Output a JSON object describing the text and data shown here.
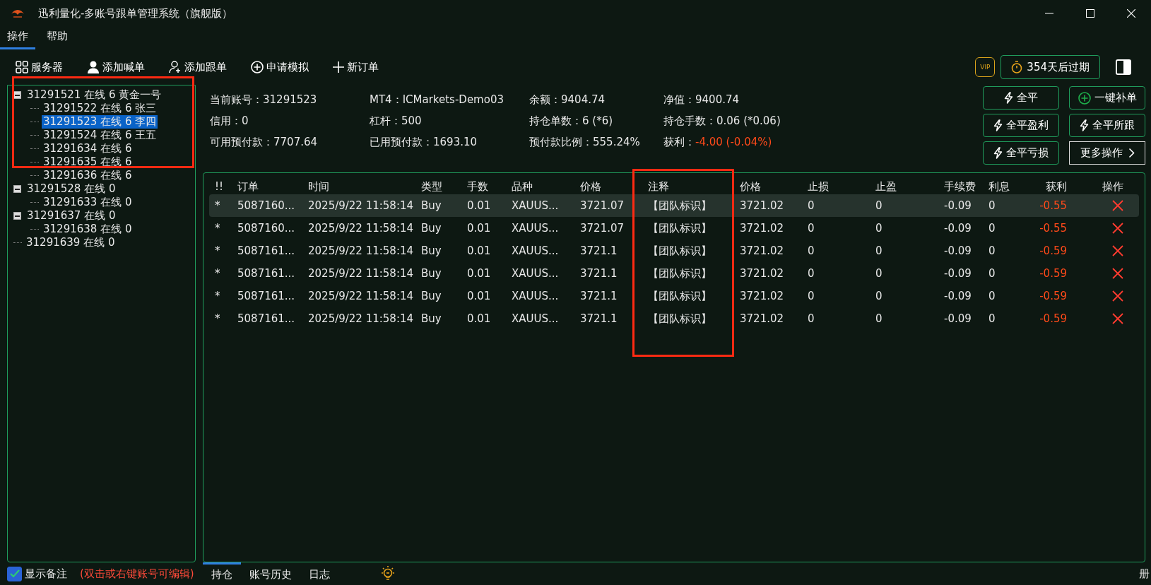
{
  "window": {
    "title": "迅利量化-多账号跟单管理系统（旗舰版）"
  },
  "menu": [
    {
      "label": "操作",
      "selected": true
    },
    {
      "label": "帮助",
      "selected": false
    }
  ],
  "toolbar": [
    {
      "label": "服务器",
      "kind": "grid"
    },
    {
      "label": "添加喊单",
      "kind": "user"
    },
    {
      "label": "添加跟单",
      "kind": "user-add"
    },
    {
      "label": "申请模拟",
      "kind": "plus-circle"
    },
    {
      "label": "新订单",
      "kind": "plus"
    }
  ],
  "license": {
    "badge": "VIP",
    "expiry": "354天后过期"
  },
  "tree": [
    {
      "label": "31291521 在线 6 黄金一号",
      "selected": false,
      "expanded": true,
      "children": [
        {
          "label": "31291522 在线 6 张三",
          "selected": false
        },
        {
          "label": "31291523 在线 6 李四",
          "selected": true
        },
        {
          "label": "31291524 在线 6 王五",
          "selected": false
        },
        {
          "label": "31291634 在线 6",
          "selected": false
        },
        {
          "label": "31291635 在线 6",
          "selected": false
        },
        {
          "label": "31291636 在线 6",
          "selected": false
        }
      ]
    },
    {
      "label": "31291528 在线 0",
      "selected": false,
      "expanded": true,
      "children": [
        {
          "label": "31291633 在线 0",
          "selected": false
        }
      ]
    },
    {
      "label": "31291637 在线 0",
      "selected": false,
      "expanded": true,
      "children": [
        {
          "label": "31291638 在线 0",
          "selected": false
        }
      ]
    },
    {
      "label": "31291639 在线 0",
      "selected": false
    }
  ],
  "account_info": [
    {
      "label": "当前账号：",
      "value": "31291523",
      "color": "#e8e8e8"
    },
    {
      "label": "MT4：",
      "value": "ICMarkets-Demo03",
      "color": "#e8e8e8"
    },
    {
      "label": "余额：",
      "value": "9404.74",
      "color": "#e8e8e8"
    },
    {
      "label": "净值：",
      "value": "9400.74",
      "color": "#e8e8e8"
    },
    {
      "label": "信用：",
      "value": "0",
      "color": "#e8e8e8"
    },
    {
      "label": "杠杆：",
      "value": "500",
      "color": "#e8e8e8"
    },
    {
      "label": "持仓单数：",
      "value": "6 (*6)",
      "color": "#e8e8e8"
    },
    {
      "label": "持仓手数：",
      "value": "0.06 (*0.06)",
      "color": "#e8e8e8"
    },
    {
      "label": "可用预付款：",
      "value": "7707.64",
      "color": "#e8e8e8"
    },
    {
      "label": "已用预付款：",
      "value": "1693.10",
      "color": "#e8e8e8"
    },
    {
      "label": "预付款比例：",
      "value": "555.24%",
      "color": "#e8e8e8"
    },
    {
      "label": "获利：",
      "value": "-4.00 (-0.04%)",
      "color": "#ff4a1a"
    }
  ],
  "actions": [
    {
      "label": "全平",
      "kind": "bolt"
    },
    {
      "label": "一键补单",
      "kind": "plus-circle"
    },
    {
      "label": "全平盈利",
      "kind": "bolt"
    },
    {
      "label": "全平所跟",
      "kind": "bolt"
    },
    {
      "label": "全平亏损",
      "kind": "bolt"
    },
    {
      "label": "更多操作",
      "kind": "chevron"
    }
  ],
  "table": {
    "columns": [
      {
        "label": "!!",
        "kind": "text"
      },
      {
        "label": "订单",
        "kind": "text"
      },
      {
        "label": "时间",
        "kind": "text"
      },
      {
        "label": "类型",
        "kind": "text"
      },
      {
        "label": "手数",
        "kind": "text"
      },
      {
        "label": "品种",
        "kind": "text"
      },
      {
        "label": "价格",
        "kind": "text"
      },
      {
        "label": "注释",
        "kind": "text"
      },
      {
        "label": "价格",
        "kind": "text"
      },
      {
        "label": "止损",
        "kind": "text"
      },
      {
        "label": "止盈",
        "kind": "text"
      },
      {
        "label": "手续费",
        "kind": "text"
      },
      {
        "label": "利息",
        "kind": "text"
      },
      {
        "label": "获利",
        "kind": "profit"
      },
      {
        "label": "操作",
        "kind": "action"
      }
    ],
    "rows": [
      {
        "selected": true,
        "cells": [
          "*",
          "5087160...",
          "2025/9/22 11:58:14",
          "Buy",
          "0.01",
          "XAUUS...",
          "3721.07",
          "【团队标识】",
          "3721.02",
          "0",
          "0",
          "-0.09",
          "0",
          "-0.55"
        ]
      },
      {
        "selected": false,
        "cells": [
          "*",
          "5087160...",
          "2025/9/22 11:58:14",
          "Buy",
          "0.01",
          "XAUUS...",
          "3721.07",
          "【团队标识】",
          "3721.02",
          "0",
          "0",
          "-0.09",
          "0",
          "-0.55"
        ]
      },
      {
        "selected": false,
        "cells": [
          "*",
          "5087161...",
          "2025/9/22 11:58:14",
          "Buy",
          "0.01",
          "XAUUS...",
          "3721.1",
          "【团队标识】",
          "3721.02",
          "0",
          "0",
          "-0.09",
          "0",
          "-0.59"
        ]
      },
      {
        "selected": false,
        "cells": [
          "*",
          "5087161...",
          "2025/9/22 11:58:14",
          "Buy",
          "0.01",
          "XAUUS...",
          "3721.1",
          "【团队标识】",
          "3721.02",
          "0",
          "0",
          "-0.09",
          "0",
          "-0.59"
        ]
      },
      {
        "selected": false,
        "cells": [
          "*",
          "5087161...",
          "2025/9/22 11:58:14",
          "Buy",
          "0.01",
          "XAUUS...",
          "3721.1",
          "【团队标识】",
          "3721.02",
          "0",
          "0",
          "-0.09",
          "0",
          "-0.59"
        ]
      },
      {
        "selected": false,
        "cells": [
          "*",
          "5087161...",
          "2025/9/22 11:58:14",
          "Buy",
          "0.01",
          "XAUUS...",
          "3721.1",
          "【团队标识】",
          "3721.02",
          "0",
          "0",
          "-0.09",
          "0",
          "-0.59"
        ]
      }
    ]
  },
  "footer": {
    "show_notes": {
      "label": "显示备注",
      "checked": true
    },
    "hint": "(双击或右键账号可编辑)",
    "tabs": [
      {
        "label": "持仓",
        "selected": true
      },
      {
        "label": "账号历史",
        "selected": false
      },
      {
        "label": "日志",
        "selected": false
      }
    ],
    "edge_text": "册"
  }
}
